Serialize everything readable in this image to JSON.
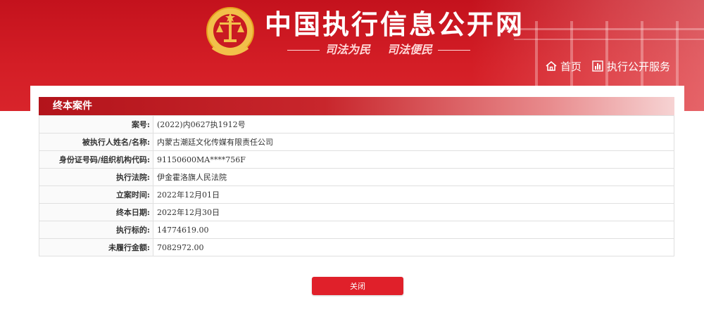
{
  "header": {
    "site_title": "中国执行信息公开网",
    "slogan_left": "司法为民",
    "slogan_right": "司法便民",
    "nav": [
      {
        "label": "首页",
        "icon": "home-icon"
      },
      {
        "label": "执行公开服务",
        "icon": "chart-bars-icon"
      }
    ]
  },
  "panel": {
    "title": "终本案件",
    "rows": [
      {
        "label": "案号:",
        "value": "(2022)内0627执1912号"
      },
      {
        "label": "被执行人姓名/名称:",
        "value": "内蒙古潮廷文化传媒有限责任公司"
      },
      {
        "label": "身份证号码/组织机构代码:",
        "value": "91150600MA****756F"
      },
      {
        "label": "执行法院:",
        "value": "伊金霍洛旗人民法院"
      },
      {
        "label": "立案时间:",
        "value": "2022年12月01日"
      },
      {
        "label": "终本日期:",
        "value": "2022年12月30日"
      },
      {
        "label": "执行标的:",
        "value": "14774619.00"
      },
      {
        "label": "未履行金额:",
        "value": "7082972.00"
      }
    ],
    "close_label": "关闭"
  },
  "colors": {
    "header_red": "#d41e26",
    "title_bar_red": "#b3141b",
    "button_red": "#e0202a",
    "emblem_gold": "#f2c04a"
  }
}
